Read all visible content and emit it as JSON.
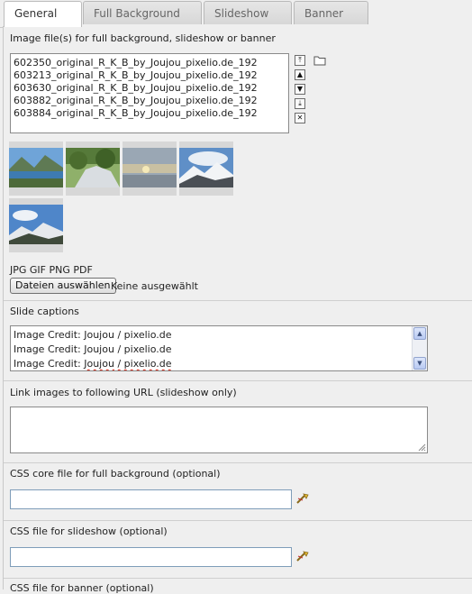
{
  "tabs": [
    "General",
    "Full Background",
    "Slideshow",
    "Banner"
  ],
  "images": {
    "label": "Image file(s) for full background, slideshow or banner",
    "files": [
      "602350_original_R_K_B_by_Joujou_pixelio.de_192",
      "603213_original_R_K_B_by_Joujou_pixelio.de_192",
      "603630_original_R_K_B_by_Joujou_pixelio.de_192",
      "603882_original_R_K_B_by_Joujou_pixelio.de_192",
      "603884_original_R_K_B_by_Joujou_pixelio.de_192"
    ],
    "buttons": {
      "top": "⤒",
      "up": "▲",
      "down": "▼",
      "bottom": "⤓",
      "remove": "✕"
    },
    "thumbnail_icons": [
      "lake-mountain-thumbnail",
      "forest-river-thumbnail",
      "cloudy-sunset-thumbnail",
      "snowy-mountain-thumbnail",
      "alpine-sky-thumbnail"
    ],
    "allowed_types": "JPG GIF PNG PDF",
    "choose_label": "Dateien auswählen",
    "none_selected": "Keine ausgewählt"
  },
  "captions": {
    "label": "Slide captions",
    "lines": [
      {
        "prefix": "Image Credit: ",
        "name": "Joujou",
        "suffix": "  / pixelio.de"
      },
      {
        "prefix": "Image Credit: ",
        "name": "Joujou",
        "suffix": "  / pixelio.de"
      },
      {
        "prefix": "Image Credit: ",
        "name": "Joujou",
        "suffix": "  / pixelio.de"
      }
    ]
  },
  "link": {
    "label": "Link images to following URL (slideshow only)",
    "value": ""
  },
  "css_core": {
    "label": "CSS core file for full background (optional)",
    "value": ""
  },
  "css_slideshow": {
    "label": "CSS file for slideshow (optional)",
    "value": ""
  },
  "css_banner": {
    "label": "CSS file for banner (optional)"
  },
  "colors": {
    "panel": "#efefef",
    "input_border": "#7f9db9",
    "scroll_arrow": "#b8c9f2"
  }
}
